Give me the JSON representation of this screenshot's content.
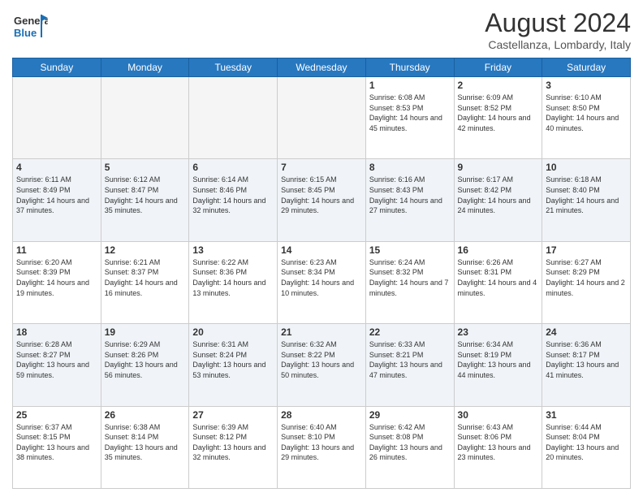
{
  "header": {
    "logo_general": "General",
    "logo_blue": "Blue",
    "month_title": "August 2024",
    "location": "Castellanza, Lombardy, Italy"
  },
  "days_of_week": [
    "Sunday",
    "Monday",
    "Tuesday",
    "Wednesday",
    "Thursday",
    "Friday",
    "Saturday"
  ],
  "weeks": [
    [
      {
        "day": "",
        "empty": true
      },
      {
        "day": "",
        "empty": true
      },
      {
        "day": "",
        "empty": true
      },
      {
        "day": "",
        "empty": true
      },
      {
        "day": "1",
        "sunrise": "6:08 AM",
        "sunset": "8:53 PM",
        "daylight": "14 hours and 45 minutes."
      },
      {
        "day": "2",
        "sunrise": "6:09 AM",
        "sunset": "8:52 PM",
        "daylight": "14 hours and 42 minutes."
      },
      {
        "day": "3",
        "sunrise": "6:10 AM",
        "sunset": "8:50 PM",
        "daylight": "14 hours and 40 minutes."
      }
    ],
    [
      {
        "day": "4",
        "sunrise": "6:11 AM",
        "sunset": "8:49 PM",
        "daylight": "14 hours and 37 minutes."
      },
      {
        "day": "5",
        "sunrise": "6:12 AM",
        "sunset": "8:47 PM",
        "daylight": "14 hours and 35 minutes."
      },
      {
        "day": "6",
        "sunrise": "6:14 AM",
        "sunset": "8:46 PM",
        "daylight": "14 hours and 32 minutes."
      },
      {
        "day": "7",
        "sunrise": "6:15 AM",
        "sunset": "8:45 PM",
        "daylight": "14 hours and 29 minutes."
      },
      {
        "day": "8",
        "sunrise": "6:16 AM",
        "sunset": "8:43 PM",
        "daylight": "14 hours and 27 minutes."
      },
      {
        "day": "9",
        "sunrise": "6:17 AM",
        "sunset": "8:42 PM",
        "daylight": "14 hours and 24 minutes."
      },
      {
        "day": "10",
        "sunrise": "6:18 AM",
        "sunset": "8:40 PM",
        "daylight": "14 hours and 21 minutes."
      }
    ],
    [
      {
        "day": "11",
        "sunrise": "6:20 AM",
        "sunset": "8:39 PM",
        "daylight": "14 hours and 19 minutes."
      },
      {
        "day": "12",
        "sunrise": "6:21 AM",
        "sunset": "8:37 PM",
        "daylight": "14 hours and 16 minutes."
      },
      {
        "day": "13",
        "sunrise": "6:22 AM",
        "sunset": "8:36 PM",
        "daylight": "14 hours and 13 minutes."
      },
      {
        "day": "14",
        "sunrise": "6:23 AM",
        "sunset": "8:34 PM",
        "daylight": "14 hours and 10 minutes."
      },
      {
        "day": "15",
        "sunrise": "6:24 AM",
        "sunset": "8:32 PM",
        "daylight": "14 hours and 7 minutes."
      },
      {
        "day": "16",
        "sunrise": "6:26 AM",
        "sunset": "8:31 PM",
        "daylight": "14 hours and 4 minutes."
      },
      {
        "day": "17",
        "sunrise": "6:27 AM",
        "sunset": "8:29 PM",
        "daylight": "14 hours and 2 minutes."
      }
    ],
    [
      {
        "day": "18",
        "sunrise": "6:28 AM",
        "sunset": "8:27 PM",
        "daylight": "13 hours and 59 minutes."
      },
      {
        "day": "19",
        "sunrise": "6:29 AM",
        "sunset": "8:26 PM",
        "daylight": "13 hours and 56 minutes."
      },
      {
        "day": "20",
        "sunrise": "6:31 AM",
        "sunset": "8:24 PM",
        "daylight": "13 hours and 53 minutes."
      },
      {
        "day": "21",
        "sunrise": "6:32 AM",
        "sunset": "8:22 PM",
        "daylight": "13 hours and 50 minutes."
      },
      {
        "day": "22",
        "sunrise": "6:33 AM",
        "sunset": "8:21 PM",
        "daylight": "13 hours and 47 minutes."
      },
      {
        "day": "23",
        "sunrise": "6:34 AM",
        "sunset": "8:19 PM",
        "daylight": "13 hours and 44 minutes."
      },
      {
        "day": "24",
        "sunrise": "6:36 AM",
        "sunset": "8:17 PM",
        "daylight": "13 hours and 41 minutes."
      }
    ],
    [
      {
        "day": "25",
        "sunrise": "6:37 AM",
        "sunset": "8:15 PM",
        "daylight": "13 hours and 38 minutes."
      },
      {
        "day": "26",
        "sunrise": "6:38 AM",
        "sunset": "8:14 PM",
        "daylight": "13 hours and 35 minutes."
      },
      {
        "day": "27",
        "sunrise": "6:39 AM",
        "sunset": "8:12 PM",
        "daylight": "13 hours and 32 minutes."
      },
      {
        "day": "28",
        "sunrise": "6:40 AM",
        "sunset": "8:10 PM",
        "daylight": "13 hours and 29 minutes."
      },
      {
        "day": "29",
        "sunrise": "6:42 AM",
        "sunset": "8:08 PM",
        "daylight": "13 hours and 26 minutes."
      },
      {
        "day": "30",
        "sunrise": "6:43 AM",
        "sunset": "8:06 PM",
        "daylight": "13 hours and 23 minutes."
      },
      {
        "day": "31",
        "sunrise": "6:44 AM",
        "sunset": "8:04 PM",
        "daylight": "13 hours and 20 minutes."
      }
    ]
  ],
  "labels": {
    "sunrise": "Sunrise:",
    "sunset": "Sunset:",
    "daylight": "Daylight:"
  }
}
